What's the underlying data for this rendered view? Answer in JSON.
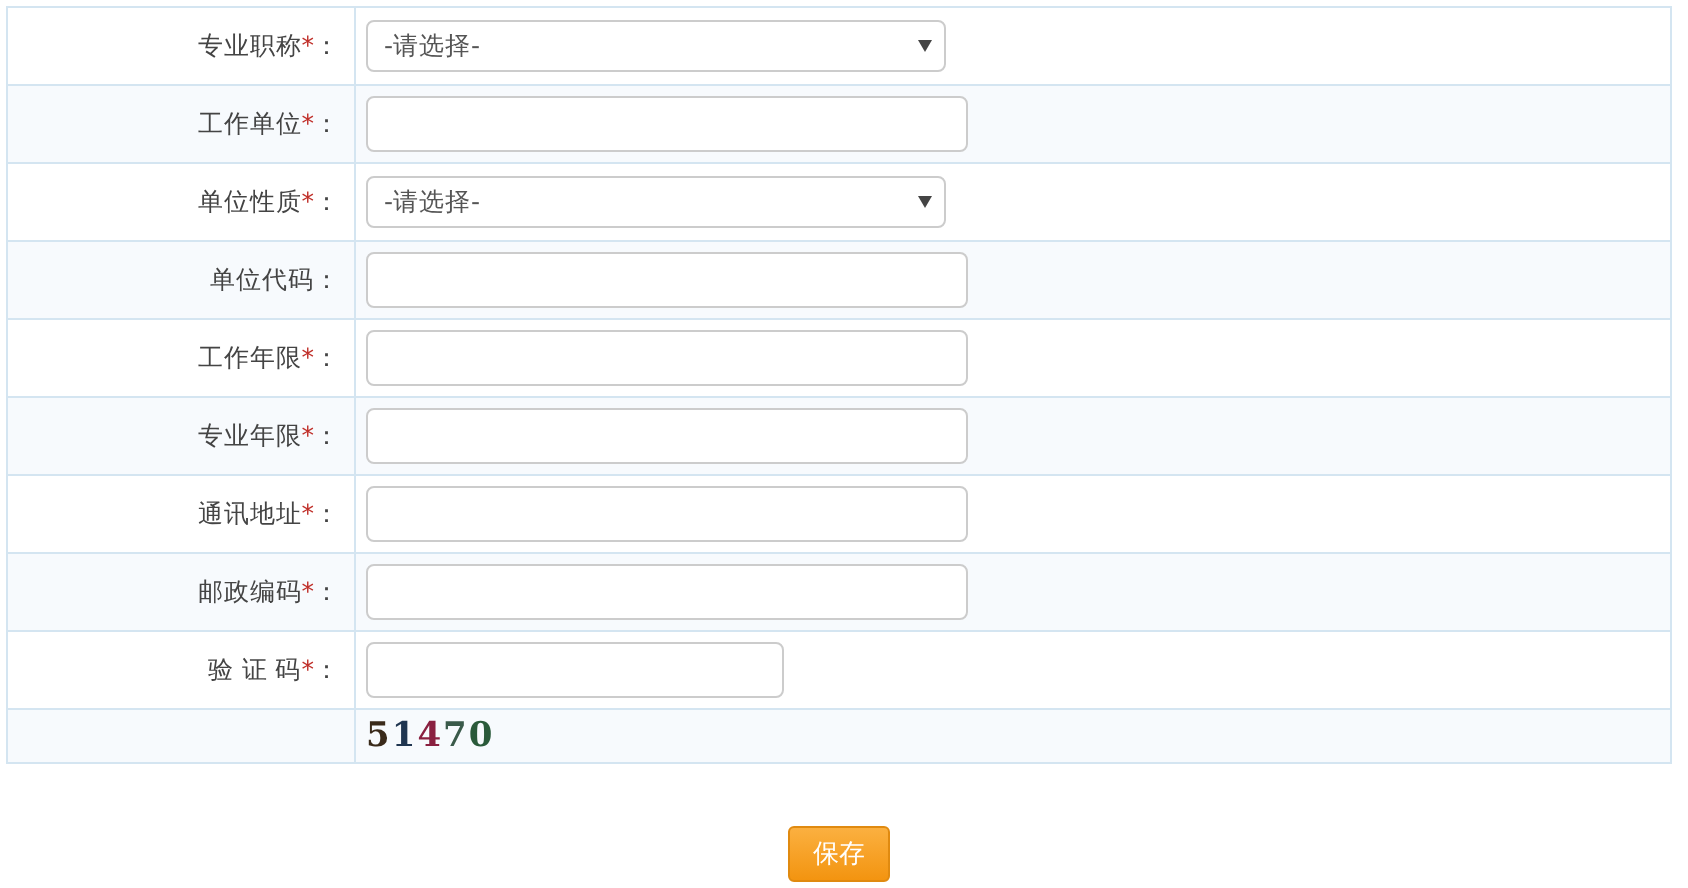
{
  "rows": [
    {
      "label": "专业职称",
      "required": true,
      "kind": "select",
      "placeholder": "-请选择-"
    },
    {
      "label": "工作单位",
      "required": true,
      "kind": "input"
    },
    {
      "label": "单位性质",
      "required": true,
      "kind": "select",
      "placeholder": "-请选择-"
    },
    {
      "label": "单位代码",
      "required": false,
      "kind": "input"
    },
    {
      "label": "工作年限",
      "required": true,
      "kind": "input"
    },
    {
      "label": "专业年限",
      "required": true,
      "kind": "input"
    },
    {
      "label": "通讯地址",
      "required": true,
      "kind": "input"
    },
    {
      "label": "邮政编码",
      "required": true,
      "kind": "input"
    },
    {
      "label": "验 证 码",
      "required": true,
      "kind": "short-input"
    }
  ],
  "required_mark": "*",
  "label_suffix": "：",
  "captcha": {
    "text": "51470"
  },
  "save_button": "保存"
}
